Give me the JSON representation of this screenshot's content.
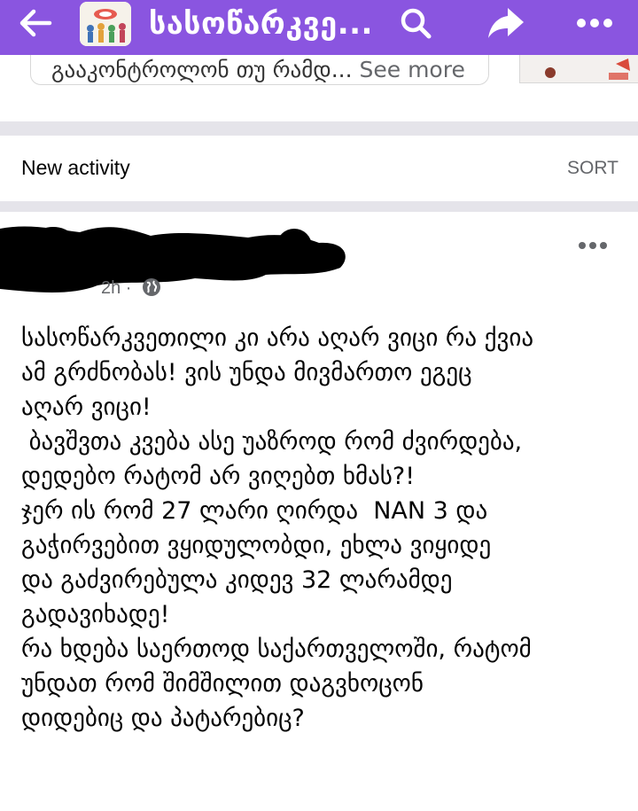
{
  "header": {
    "group_title": "სასოწარკვე...",
    "back_icon": "arrow-left-icon",
    "search_icon": "search-icon",
    "share_icon": "share-icon",
    "more_icon": "more-horizontal-icon",
    "bar_color": "#8a55e0"
  },
  "previous_post": {
    "snippet": "გააკონტროლონ თუ რამდ...",
    "see_more": " See more"
  },
  "activity": {
    "label": "New activity",
    "sort_label": "SORT"
  },
  "post": {
    "time": "2h ·",
    "privacy_icon": "globe-icon",
    "more_icon": "more-horizontal-icon",
    "lines": [
      "სასოწარკვეთილი კი არა აღარ ვიცი რა ქვია",
      "ამ გრძნობას! ვის უნდა მივმართო ეგეც",
      "აღარ ვიცი!",
      " ბავშვთა კვება ასე უაზროდ რომ ძვირდება,",
      "დედებო რატომ არ ვიღებთ ხმას?!",
      "ჯერ ის რომ 27 ლარი ღირდა  NAN 3 და",
      "გაჭირვებით ვყიდულობდი, ეხლა ვიყიდე",
      "და გაძვირებულა კიდევ 32 ლარამდე",
      "გადავიხადე!",
      "რა ხდება საერთოდ საქართველოში, რატომ",
      "უნდათ რომ შიმშილით დაგვხოცონ",
      "დიდებიც და პატარებიც?"
    ]
  }
}
